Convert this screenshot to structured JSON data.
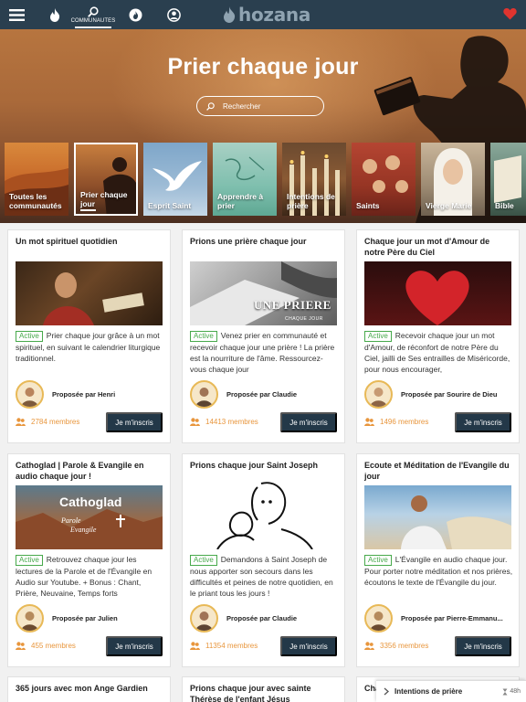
{
  "nav": {
    "communities_label": "COMMUNAUTES",
    "brand": "hozana",
    "icons": [
      "menu-icon",
      "flame-icon",
      "search-icon",
      "globe-flame-icon",
      "user-icon",
      "heart-icon"
    ]
  },
  "hero": {
    "title": "Prier chaque jour",
    "search_placeholder": "Rechercher"
  },
  "categories": [
    {
      "label": "Toutes les communautés"
    },
    {
      "label": "Prier chaque jour"
    },
    {
      "label": "Esprit Saint"
    },
    {
      "label": "Apprendre à prier"
    },
    {
      "label": "Intentions de prière"
    },
    {
      "label": "Saints"
    },
    {
      "label": "Vierge Marie"
    },
    {
      "label": "Bible"
    }
  ],
  "cards": [
    {
      "title": "Un mot spirituel quotidien",
      "badge": "Active",
      "desc": "Prier chaque jour grâce à un mot spirituel, en suivant le calendrier liturgique traditionnel.",
      "proposer": "Proposée par Henri",
      "members": "2784 membres",
      "join": "Je m'inscris"
    },
    {
      "title": "Prions une prière chaque jour",
      "badge": "Active",
      "desc": "Venez prier en communauté et recevoir chaque jour une prière ! La prière est la nourriture de l'âme. Ressourcez-vous chaque jour",
      "proposer": "Proposée par Claudie",
      "members": "14413 membres",
      "join": "Je m'inscris",
      "image_text": [
        "UNE PRIERE",
        "CHAQUE JOUR"
      ]
    },
    {
      "title": "Chaque jour un mot d'Amour de notre Père du Ciel",
      "badge": "Active",
      "desc": "Recevoir chaque jour un mot d'Amour, de réconfort de notre Père du Ciel, jailli de Ses entrailles de Miséricorde, pour nous encourager,",
      "proposer": "Proposée par Sourire de Dieu",
      "members": "1496 membres",
      "join": "Je m'inscris"
    },
    {
      "title": "Cathoglad | Parole & Evangile en audio chaque jour !",
      "badge": "Active",
      "desc": "Retrouvez chaque jour les lectures de la Parole et de l'Évangile en Audio sur Youtube. + Bonus : Chant, Prière, Neuvaine, Temps forts",
      "proposer": "Proposée par Julien",
      "members": "455 membres",
      "join": "Je m'inscris",
      "image_text": [
        "Cathoglad",
        "Parole",
        "Evangile"
      ]
    },
    {
      "title": "Prions chaque jour Saint Joseph",
      "badge": "Active",
      "desc": "Demandons à Saint Joseph de nous apporter son secours dans les difficultés et peines de notre quotidien, en le priant tous les jours !",
      "proposer": "Proposée par Claudie",
      "members": "11354 membres",
      "join": "Je m'inscris"
    },
    {
      "title": "Ecoute et Méditation de l'Evangile du jour",
      "badge": "Active",
      "desc": "L'Évangile en audio chaque jour. Pour porter notre méditation et nos prières, écoutons le texte de l'Évangile du jour.",
      "proposer": "Proposée par Pierre-Emmanu...",
      "members": "3356 membres",
      "join": "Je m'inscris"
    },
    {
      "title": "365 jours avec mon Ange Gardien"
    },
    {
      "title": "Prions chaque jour avec sainte Thérèse de l'enfant Jésus"
    },
    {
      "title": "Cha"
    }
  ],
  "prayer_panel": {
    "label": "Intentions de prière",
    "time": "48h"
  },
  "colors": {
    "nav_bg": "#2a3f4f",
    "button_bg": "#233848",
    "active_green": "#47a94b",
    "members_orange": "#e8963d",
    "heart_red": "#e0342f"
  }
}
